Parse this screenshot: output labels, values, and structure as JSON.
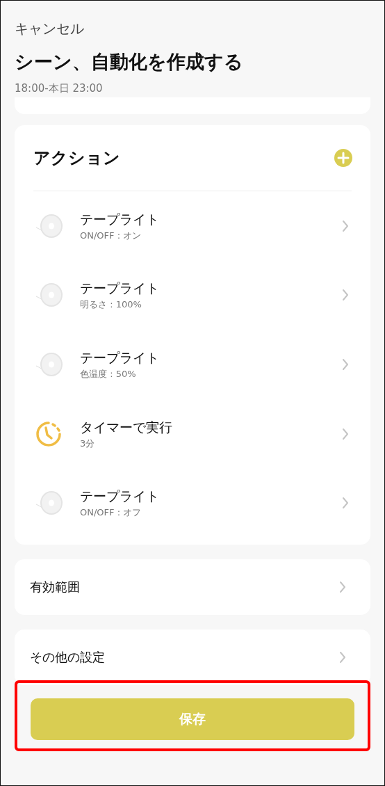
{
  "header": {
    "cancel": "キャンセル",
    "title": "シーン、自動化を作成する",
    "subtitle": "18:00-本日 23:00"
  },
  "actions": {
    "title": "アクション",
    "items": [
      {
        "kind": "device",
        "title": "テープライト",
        "detail": "ON/OFF : オン"
      },
      {
        "kind": "device",
        "title": "テープライト",
        "detail": "明るさ : 100%"
      },
      {
        "kind": "device",
        "title": "テープライト",
        "detail": "色温度 : 50%"
      },
      {
        "kind": "timer",
        "title": "タイマーで実行",
        "detail": "3分"
      },
      {
        "kind": "device",
        "title": "テープライト",
        "detail": "ON/OFF : オフ"
      }
    ]
  },
  "settings": [
    "有効範囲",
    "その他の設定"
  ],
  "save_button": {
    "label": "保存",
    "highlighted": true
  }
}
